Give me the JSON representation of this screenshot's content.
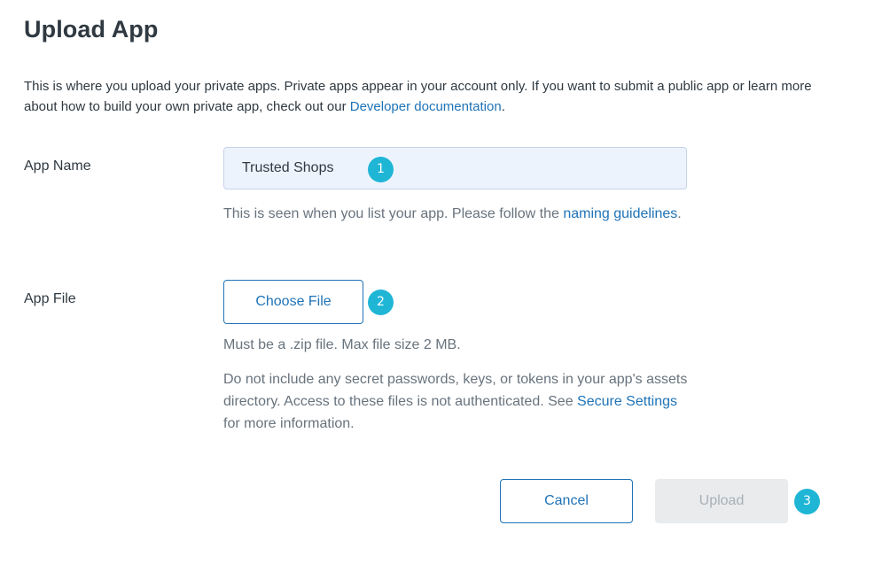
{
  "page": {
    "title": "Upload App"
  },
  "intro": {
    "text": "This is where you upload your private apps. Private apps appear in your account only. If you want to submit a public app or learn more about how to build your own private app, check out our ",
    "link": "Developer documentation",
    "suffix": "."
  },
  "app_name": {
    "label": "App Name",
    "value": "Trusted Shops",
    "hint_text": "This is seen when you list your app. Please follow the ",
    "hint_link": "naming guidelines",
    "hint_suffix": "."
  },
  "app_file": {
    "label": "App File",
    "button_label": "Choose File",
    "hint_zip": "Must be a .zip file. Max file size 2 MB.",
    "hint_secret_text": "Do not include any secret passwords, keys, or tokens in your app's assets directory. Access to these files is not authenticated. See ",
    "hint_secret_link": "Secure Settings",
    "hint_secret_suffix": " for more information."
  },
  "footer": {
    "cancel_label": "Cancel",
    "upload_label": "Upload"
  },
  "badges": [
    "1",
    "2",
    "3"
  ],
  "colors": {
    "link": "#1f73b7",
    "badge": "#1fb6d6",
    "input_bg": "#edf3fd",
    "disabled_bg": "#e9ebed"
  }
}
